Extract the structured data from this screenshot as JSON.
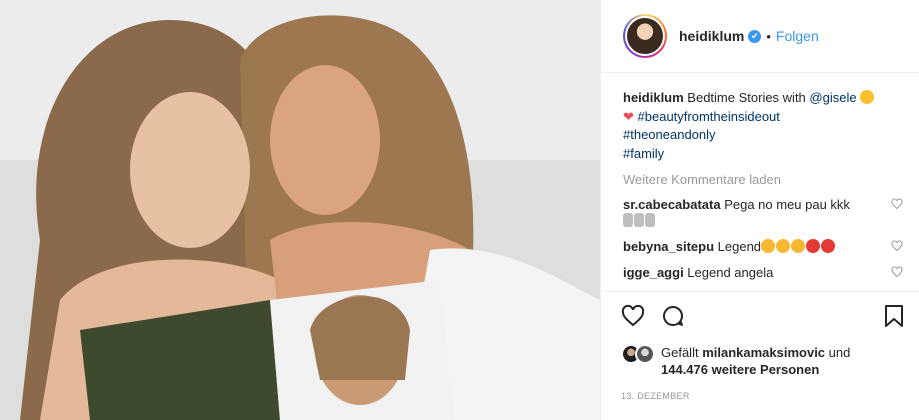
{
  "post": {
    "username": "heidiklum",
    "verified_mark": "✔",
    "dot": "•",
    "follow_label": "Folgen"
  },
  "caption": {
    "user": "heidiklum",
    "text_before": " Bedtime Stories with ",
    "mention": "@gisele",
    "heart": "❤",
    "tags": [
      "#beautyfromtheinsideout",
      "#theoneandonly",
      "#family"
    ]
  },
  "load_more": "Weitere Kommentare laden",
  "comments": [
    {
      "user": "sr.cabecabatata",
      "text": " Pega no meu pau kkk"
    },
    {
      "user": "bebyna_sitepu",
      "text": " Legend"
    },
    {
      "user": "igge_aggi",
      "text": " Legend angela"
    }
  ],
  "icons": {
    "like": "heart-outline-icon",
    "comment": "comment-bubble-icon",
    "share": "share-plane-icon",
    "save": "bookmark-icon",
    "comment_like": "heart-small-icon"
  },
  "likes": {
    "prefix": "Gefällt ",
    "user": "milankamaksimovic",
    "middle": " und ",
    "count": "144.476 weitere Personen"
  },
  "date": "13. DEZEMBER",
  "colors": {
    "link": "#003569",
    "follow": "#3897f0",
    "muted": "#999999"
  }
}
